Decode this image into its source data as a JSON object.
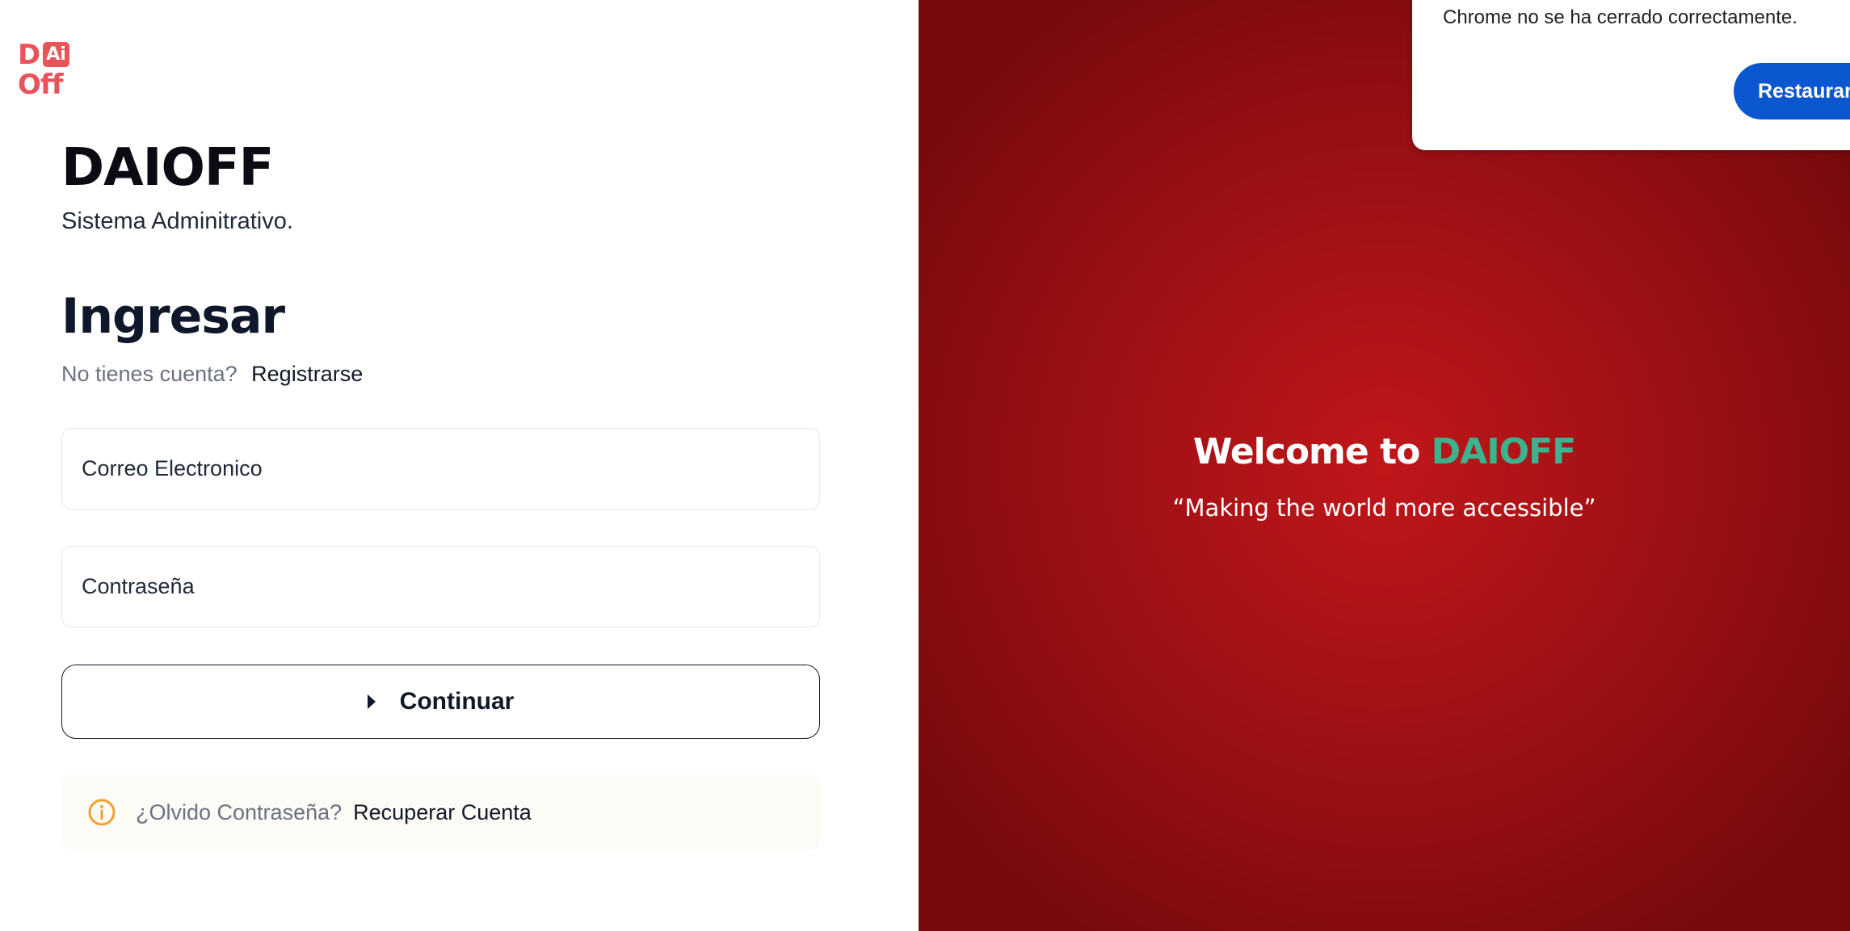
{
  "logo": {
    "letter_d": "D",
    "letter_ai": "Ai",
    "word_off": "Off"
  },
  "brand": {
    "title": "DAIOFF",
    "subtitle": "Sistema Adminitrativo."
  },
  "login": {
    "title": "Ingresar",
    "no_account_text": "No tienes cuenta?",
    "signup_link": "Registrarse",
    "email_placeholder": "Correo Electronico",
    "password_placeholder": "Contraseña",
    "continue_label": "Continuar",
    "forgot_text": "¿Olvido Contraseña?",
    "recover_link": "Recuperar Cuenta"
  },
  "hero": {
    "welcome_prefix": "Welcome to",
    "welcome_brand": "DAIOFF",
    "tagline": "“Making the world more accessible”"
  },
  "chrome_popup": {
    "message": "Chrome no se ha cerrado correctamente.",
    "restore_label": "Restaurar"
  },
  "colors": {
    "logo_red": "#e8545a",
    "hero_red": "#c0171a",
    "accent_teal": "#3bb38f",
    "chrome_blue": "#0b57d0",
    "info_orange": "#f0a030"
  },
  "icons": {
    "continue": "caret-right-icon",
    "forgot": "info-circle-icon"
  }
}
